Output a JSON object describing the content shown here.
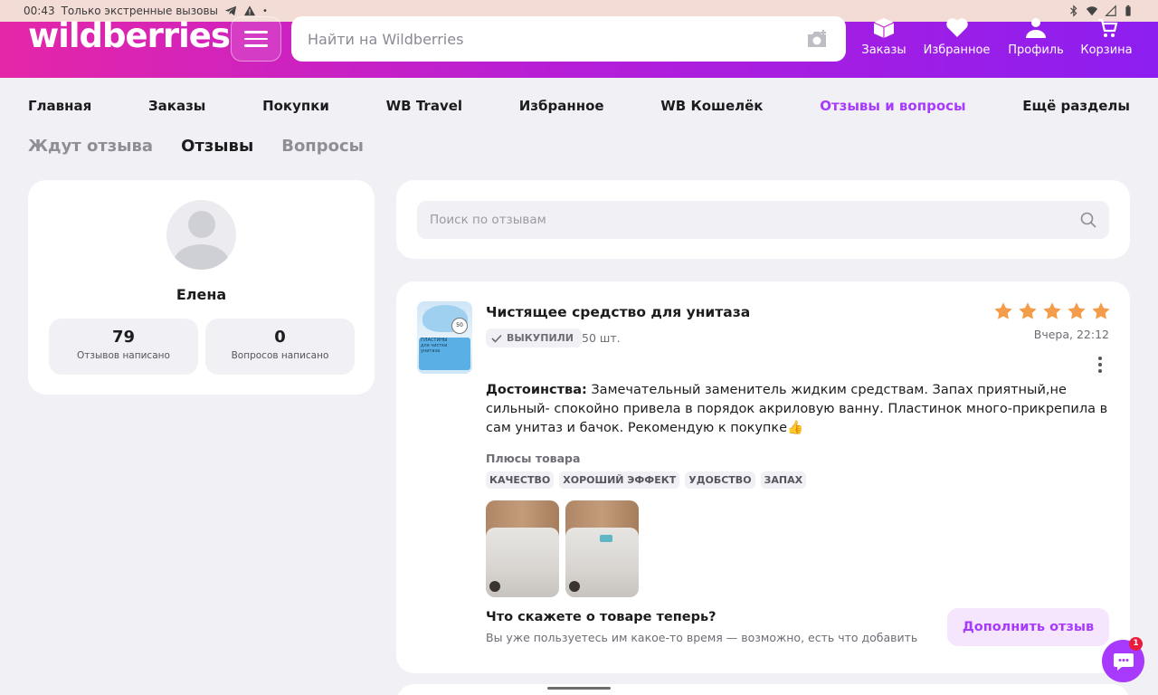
{
  "status_bar": {
    "time": "00:43",
    "message": "Только экстренные вызовы"
  },
  "header": {
    "logo": "wildberries",
    "search_placeholder": "Найти на Wildberries",
    "nav": [
      {
        "label": "Заказы",
        "icon": "box-icon"
      },
      {
        "label": "Избранное",
        "icon": "heart-icon"
      },
      {
        "label": "Профиль",
        "icon": "user-icon"
      },
      {
        "label": "Корзина",
        "icon": "cart-icon"
      }
    ]
  },
  "top_menu": [
    "Главная",
    "Заказы",
    "Покупки",
    "WB Travel",
    "Избранное",
    "WB Кошелёк",
    "Отзывы и вопросы",
    "Ещё разделы"
  ],
  "subtabs": [
    "Ждут отзыва",
    "Отзывы",
    "Вопросы"
  ],
  "profile": {
    "name": "Елена",
    "reviews_count": "79",
    "reviews_label": "Отзывов написано",
    "questions_count": "0",
    "questions_label": "Вопросов написано"
  },
  "review_search": {
    "placeholder": "Поиск по отзывам"
  },
  "review": {
    "product_title": "Чистящее средство для унитаза",
    "thumb_text": "ПЛАСТИНЫ для чистки унитаза",
    "thumb_badge": "50",
    "bought_label": "ВЫКУПИЛИ",
    "quantity": "50 шт.",
    "rating": 5,
    "date": "Вчера, 22:12",
    "text_label": "Достоинства:",
    "text": "Замечательный заменитель жидким средствам. Запах приятный,не сильный- спокойно привела в порядок акриловую ванну. Пластинок много-прикрепила в сам унитаз и бачок. Рекомендую к покупке👍",
    "plus_title": "Плюсы товара",
    "tags": [
      "КАЧЕСТВО",
      "ХОРОШИЙ ЭФФЕКТ",
      "УДОБСТВО",
      "ЗАПАХ"
    ],
    "followup_title": "Что скажете о товаре теперь?",
    "followup_sub": "Вы уже пользуетесь им какое-то время — возможно, есть что добавить",
    "add_button": "Дополнить отзыв"
  },
  "chat": {
    "badge": "1"
  },
  "colors": {
    "accent": "#a73afd",
    "star": "#f49c4a",
    "header_start": "#e526a8",
    "header_end": "#8d1ef0"
  }
}
